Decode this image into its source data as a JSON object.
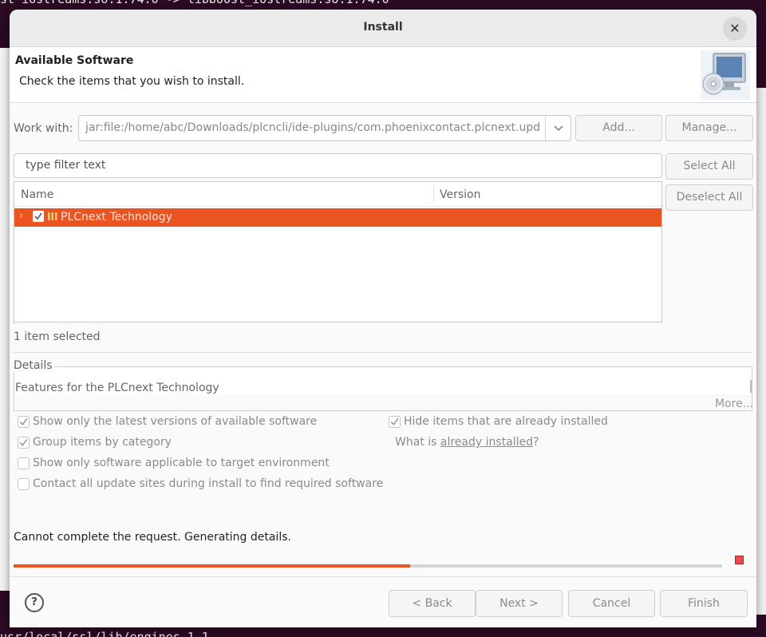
{
  "background": {
    "terminal_top": "st iostreams.so.1.74.0 -> libboost_iostreams.so.1.74.0",
    "terminal_bottom": "usr/local/ssl/lib/engines-1.1"
  },
  "window": {
    "title": "Install",
    "close_glyph": "✕"
  },
  "header": {
    "title": "Available Software",
    "subtitle": "Check the items that you wish to install.",
    "icon": "cd-monitor-icon"
  },
  "work_with": {
    "label": "Work with:",
    "value": "jar:file:/home/abc/Downloads/plcncli/ide-plugins/com.phoenixcontact.plcnext.updatesite",
    "add_label": "Add...",
    "manage_label": "Manage..."
  },
  "filter": {
    "placeholder": "type filter text"
  },
  "side_buttons": {
    "select_all": "Select All",
    "deselect_all": "Deselect All"
  },
  "tree": {
    "columns": [
      "Name",
      "Version"
    ],
    "rows": [
      {
        "label": "PLCnext Technology",
        "version": "",
        "checked": true,
        "selected": true,
        "expanded": false
      }
    ]
  },
  "selection_status": "1 item selected",
  "details": {
    "label": "Details",
    "text": "Features for the PLCnext Technology",
    "more": "More..."
  },
  "options": {
    "latest_versions": {
      "label": "Show only the latest versions of available software",
      "checked": true
    },
    "hide_installed": {
      "label": "Hide items that are already installed",
      "checked": true
    },
    "group_by_category": {
      "label": "Group items by category",
      "checked": true
    },
    "what_is_prefix": "What is ",
    "already_installed_link": "already installed",
    "what_is_suffix": "?",
    "target_env": {
      "label": "Show only software applicable to target environment",
      "checked": false
    },
    "contact_sites": {
      "label": "Contact all update sites during install to find required software",
      "checked": false
    }
  },
  "status": {
    "message": "Cannot complete the request.  Generating details.",
    "progress": 0.56
  },
  "footer": {
    "help_glyph": "?",
    "back": "< Back",
    "next": "Next >",
    "cancel": "Cancel",
    "finish": "Finish"
  },
  "colors": {
    "accent": "#e95420",
    "stop": "#e84b4b"
  }
}
